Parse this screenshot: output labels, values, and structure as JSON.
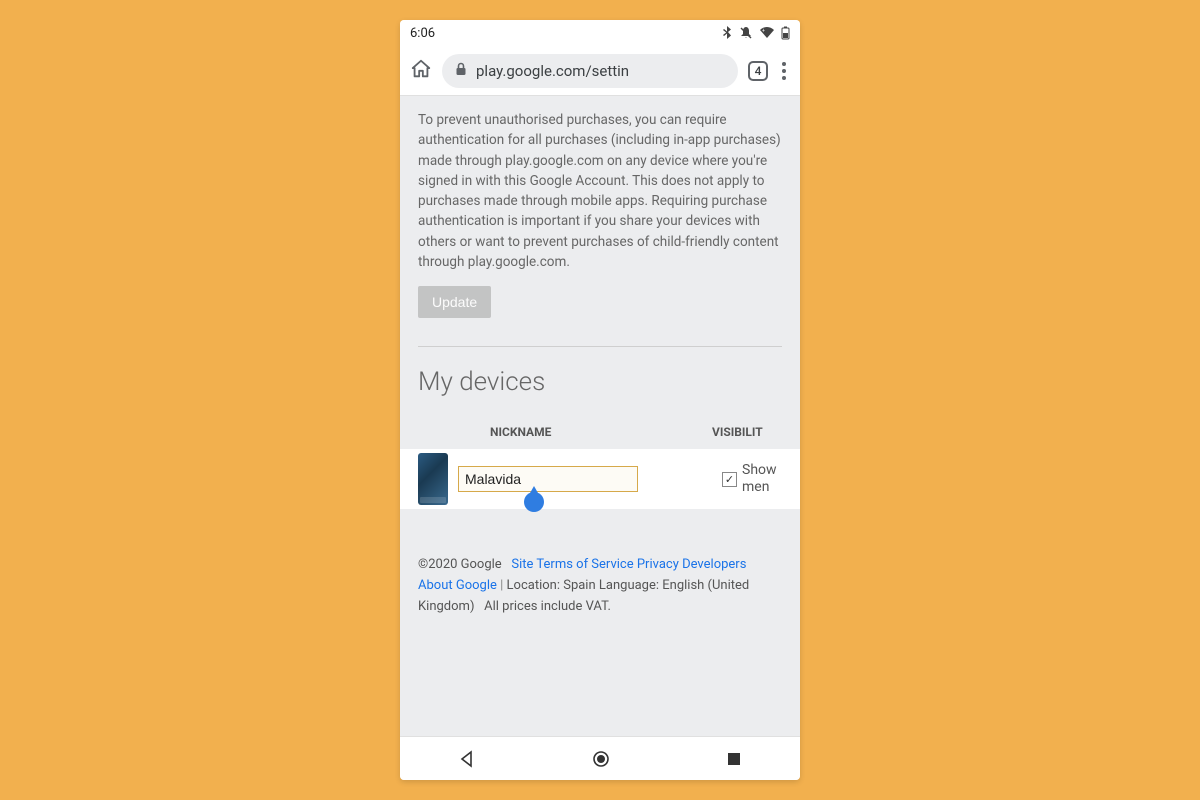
{
  "status": {
    "time": "6:06",
    "icons": {
      "bluetooth": "bluetooth-icon",
      "dnd": "bell-off-icon",
      "wifi": "wifi-icon",
      "battery": "battery-icon"
    }
  },
  "browser": {
    "url": "play.google.com/settin",
    "tab_count": "4"
  },
  "page": {
    "auth_description": "To prevent unauthorised purchases, you can require authentication for all purchases (including in-app purchases) made through play.google.com on any device where you're signed in with this Google Account. This does not apply to purchases made through mobile apps. Requiring purchase authentication is important if you share your devices with others or want to prevent purchases of child-friendly content through play.google.com.",
    "update_label": "Update",
    "section_title": "My devices",
    "headers": {
      "nickname": "NICKNAME",
      "visibility": "VISIBILIT"
    },
    "device": {
      "nickname_value": "Malavida",
      "visibility_checked": true,
      "visibility_label_line1": "Show",
      "visibility_label_line2": "men"
    }
  },
  "footer": {
    "copyright": "©2020 Google",
    "links": {
      "site_terms": "Site Terms of Service",
      "privacy": "Privacy",
      "developers": "Developers",
      "about": "About Google"
    },
    "location_label": "Location:",
    "location_value": "Spain",
    "language_label": "Language:",
    "language_value": "English (United Kingdom)",
    "vat": "All prices include VAT."
  }
}
